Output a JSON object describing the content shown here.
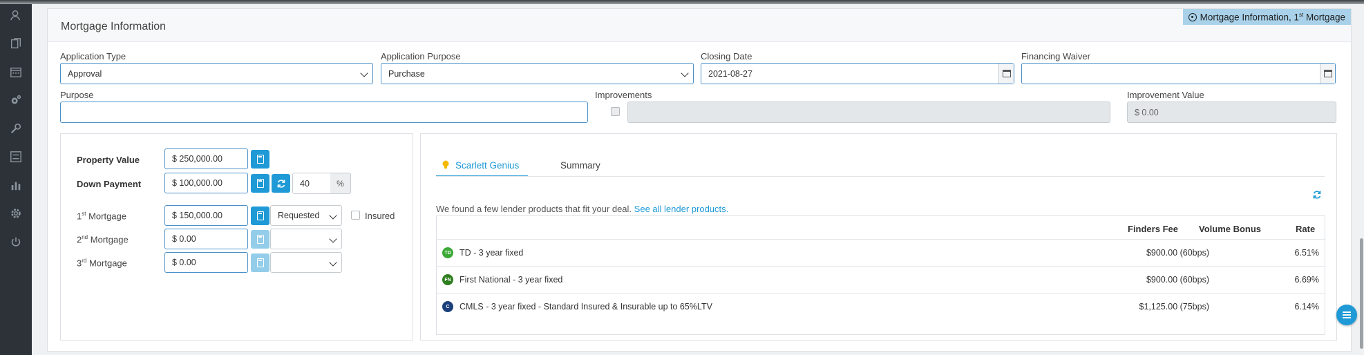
{
  "sidebar": {
    "icons": [
      "contacts-icon",
      "documents-icon",
      "calendar-icon",
      "settings-gears-icon",
      "tools-icon",
      "checklist-icon",
      "reports-icon",
      "gear-icon",
      "power-icon"
    ]
  },
  "card": {
    "title": "Mortgage Information",
    "breadcrumb": {
      "prefix": "Mortgage Information, 1",
      "sup": "st",
      "suffix": " Mortgage"
    }
  },
  "form": {
    "application_type": {
      "label": "Application Type",
      "value": "Approval"
    },
    "application_purpose": {
      "label": "Application Purpose",
      "value": "Purchase"
    },
    "closing_date": {
      "label": "Closing Date",
      "value": "2021-08-27"
    },
    "financing_waiver": {
      "label": "Financing Waiver",
      "value": ""
    },
    "purpose": {
      "label": "Purpose",
      "value": ""
    },
    "improvements": {
      "label": "Improvements",
      "value": ""
    },
    "improvement_value": {
      "label": "Improvement Value",
      "value": "$ 0.00"
    }
  },
  "left_panel": {
    "property_value": {
      "label": "Property Value",
      "value": "$ 250,000.00"
    },
    "down_payment": {
      "label": "Down Payment",
      "value": "$ 100,000.00",
      "percent": "40",
      "percent_unit": "%"
    },
    "mortgages": [
      {
        "label_num": "1",
        "label_sup": "st",
        "label_text": " Mortgage",
        "value": "$ 150,000.00",
        "status": "Requested"
      },
      {
        "label_num": "2",
        "label_sup": "nd",
        "label_text": " Mortgage",
        "value": "$ 0.00",
        "status": ""
      },
      {
        "label_num": "3",
        "label_sup": "rd",
        "label_text": " Mortgage",
        "value": "$ 0.00",
        "status": ""
      }
    ],
    "insured_label": "Insured"
  },
  "right_panel": {
    "tabs": [
      "Scarlett Genius",
      "Summary"
    ],
    "message": "We found a few lender products that fit your deal.",
    "see_all_link": "See all lender products.",
    "columns": [
      "Finders Fee",
      "Volume Bonus",
      "Rate"
    ],
    "rows": [
      {
        "logo": "TD",
        "logo_color": "#3aa935",
        "product": "TD - 3 year fixed",
        "finders_fee": "$900.00 (60bps)",
        "volume_bonus": "",
        "rate": "6.51%"
      },
      {
        "logo": "FN",
        "logo_color": "#2e7d1e",
        "product": "First National - 3 year fixed",
        "finders_fee": "$900.00 (60bps)",
        "volume_bonus": "",
        "rate": "6.69%"
      },
      {
        "logo": "C",
        "logo_color": "#1b3f7a",
        "product": "CMLS - 3 year fixed - Standard Insured & Insurable up to 65%LTV",
        "finders_fee": "$1,125.00 (75bps)",
        "volume_bonus": "",
        "rate": "6.14%"
      }
    ]
  },
  "colors": {
    "accent": "#1f9ad6",
    "sidebar": "#2c3238",
    "breadcrumb_bg": "#a9d2ea"
  }
}
